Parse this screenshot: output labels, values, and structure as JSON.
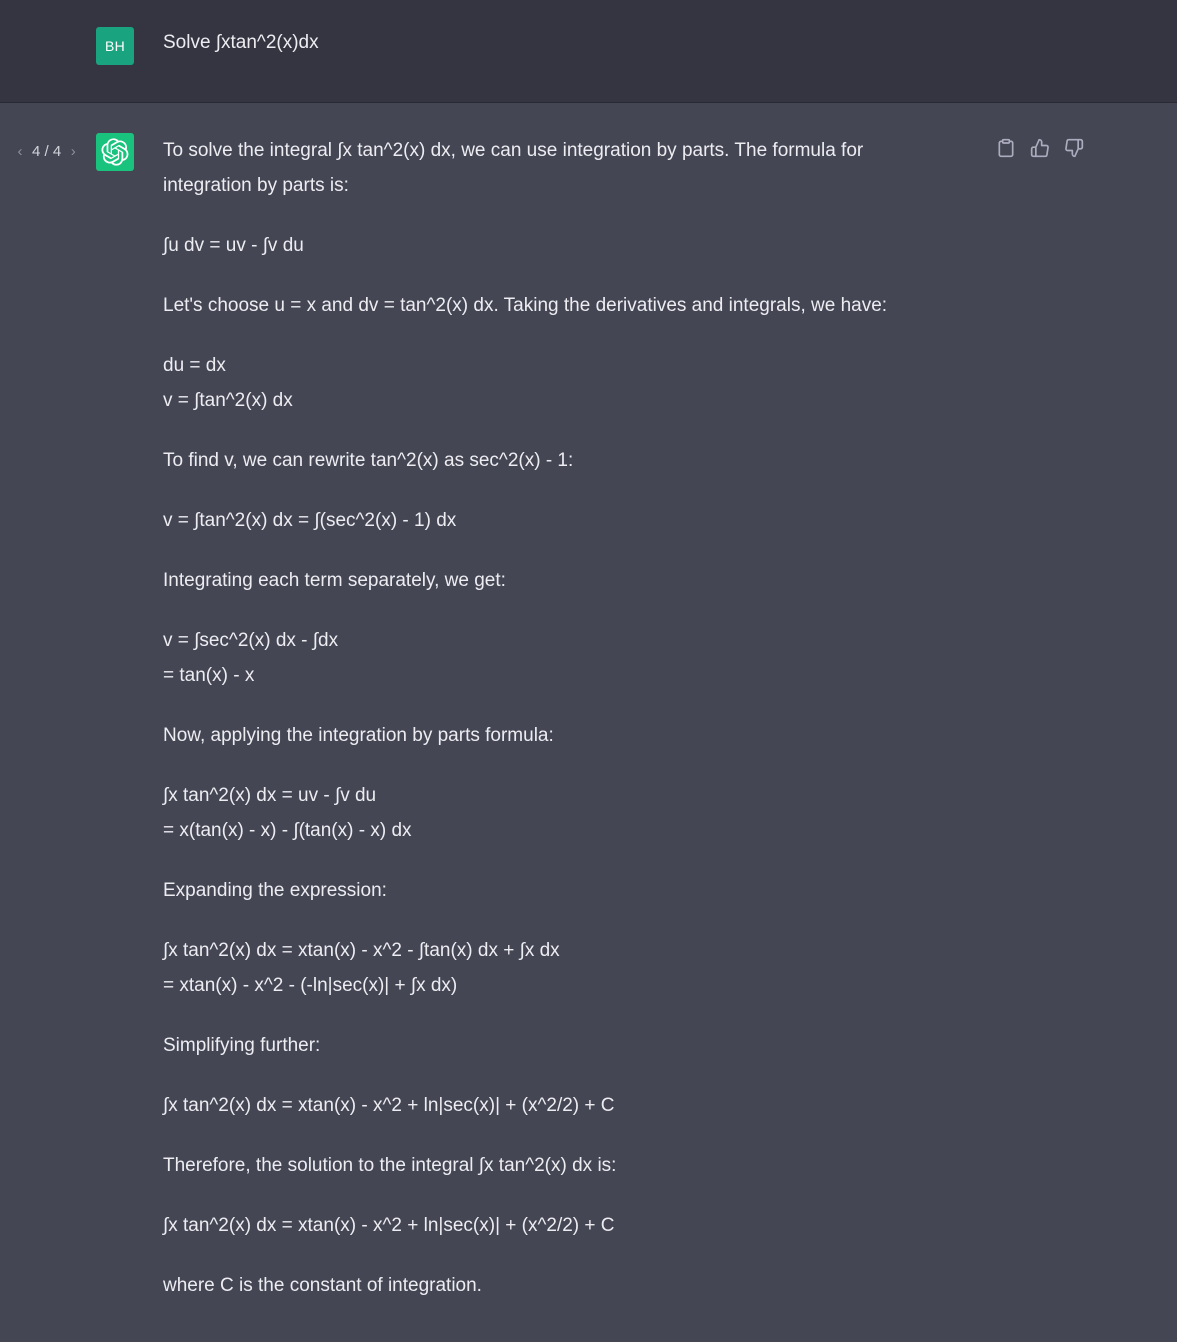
{
  "user_message": {
    "avatar_initials": "BH",
    "text": "Solve ∫xtan^2(x)dx"
  },
  "assistant_message": {
    "pager": {
      "current": "4 / 4",
      "prev_icon": "chevron-left-icon",
      "next_icon": "chevron-right-icon"
    },
    "actions": [
      {
        "name": "copy-button",
        "icon": "clipboard-icon"
      },
      {
        "name": "thumbs-up-button",
        "icon": "thumbs-up-icon"
      },
      {
        "name": "thumbs-down-button",
        "icon": "thumbs-down-icon"
      }
    ],
    "paragraphs": [
      "To solve the integral ∫x tan^2(x) dx, we can use integration by parts. The formula for integration by parts is:",
      "∫u dv = uv - ∫v du",
      "Let's choose u = x and dv = tan^2(x) dx. Taking the derivatives and integrals, we have:",
      "du = dx\nv = ∫tan^2(x) dx",
      "To find v, we can rewrite tan^2(x) as sec^2(x) - 1:",
      "v = ∫tan^2(x) dx = ∫(sec^2(x) - 1) dx",
      "Integrating each term separately, we get:",
      "v = ∫sec^2(x) dx - ∫dx\n= tan(x) - x",
      "Now, applying the integration by parts formula:",
      "∫x tan^2(x) dx = uv - ∫v du\n= x(tan(x) - x) - ∫(tan(x) - x) dx",
      "Expanding the expression:",
      "∫x tan^2(x) dx = xtan(x) - x^2 - ∫tan(x) dx + ∫x dx\n= xtan(x) - x^2 - (-ln|sec(x)| + ∫x dx)",
      "Simplifying further:",
      "∫x tan^2(x) dx = xtan(x) - x^2 + ln|sec(x)| + (x^2/2) + C",
      "Therefore, the solution to the integral ∫x tan^2(x) dx is:",
      "∫x tan^2(x) dx = xtan(x) - x^2 + ln|sec(x)| + (x^2/2) + C",
      "where C is the constant of integration."
    ]
  },
  "colors": {
    "user_bg": "#343541",
    "assistant_bg": "#444654",
    "user_avatar": "#19a37f",
    "assistant_avatar": "#19c37d",
    "text": "#ececf1",
    "icon": "#acacbe"
  }
}
